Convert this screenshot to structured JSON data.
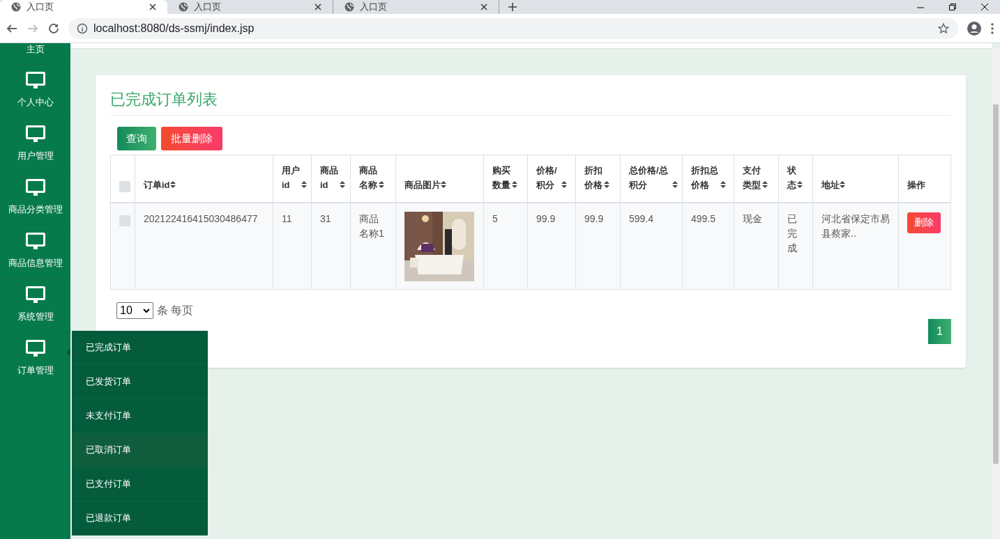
{
  "browser": {
    "tabs": [
      {
        "title": "入口页",
        "selected": true
      },
      {
        "title": "入口页",
        "selected": false
      },
      {
        "title": "入口页",
        "selected": false
      }
    ],
    "address": "localhost:8080/ds-ssmj/index.jsp"
  },
  "sidebar": {
    "items": [
      {
        "label": "主页",
        "expanded": false
      },
      {
        "label": "个人中心",
        "expanded": false
      },
      {
        "label": "用户管理",
        "expanded": false
      },
      {
        "label": "商品分类管理",
        "expanded": false
      },
      {
        "label": "商品信息管理",
        "expanded": false
      },
      {
        "label": "系统管理",
        "expanded": false
      },
      {
        "label": "订单管理",
        "expanded": true,
        "submenu": [
          {
            "label": "已完成订单",
            "hovered": false
          },
          {
            "label": "已发货订单",
            "hovered": false
          },
          {
            "label": "未支付订单",
            "hovered": false
          },
          {
            "label": "已取消订单",
            "hovered": true
          },
          {
            "label": "已支付订单",
            "hovered": false
          },
          {
            "label": "已退款订单",
            "hovered": false
          }
        ]
      }
    ]
  },
  "card": {
    "title": "已完成订单列表",
    "buttons": [
      {
        "kind": "search",
        "label": "查询"
      },
      {
        "kind": "danger",
        "label": "批量删除"
      }
    ]
  },
  "table": {
    "columns": [
      {
        "kind": "check",
        "checked": false
      },
      {
        "label": "订单id",
        "sortable": true
      },
      {
        "label": "用户id",
        "sortable": true
      },
      {
        "label": "商品id",
        "sortable": true
      },
      {
        "label": "商品名称",
        "sortable": true
      },
      {
        "label": "商品图片",
        "sortable": true
      },
      {
        "label": "购买数量",
        "sortable": true
      },
      {
        "label": "价格/积分",
        "sortable": true
      },
      {
        "label": "折扣价格",
        "sortable": true
      },
      {
        "label": "总价格/总积分",
        "sortable": true
      },
      {
        "label": "折扣总价格",
        "sortable": true
      },
      {
        "label": "支付类型",
        "sortable": true
      },
      {
        "label": "状态",
        "sortable": true
      },
      {
        "label": "地址",
        "sortable": true
      },
      {
        "label": "操作",
        "sortable": false
      }
    ],
    "rows": [
      {
        "cells": [
          {
            "kind": "check",
            "checked": false
          },
          "202122416415030486477",
          "11",
          "31",
          "商品名称1",
          {
            "kind": "picture"
          },
          "5",
          "99.9",
          "99.9",
          "599.4",
          "499.5",
          "现金",
          "已完成",
          "河北省保定市易县蔡家..",
          {
            "kind": "button",
            "label": "删除"
          }
        ]
      }
    ]
  },
  "pager": {
    "page_size": "10",
    "page_size_label": "条 每页",
    "pages": [
      {
        "label": "1",
        "selected": true
      }
    ]
  }
}
